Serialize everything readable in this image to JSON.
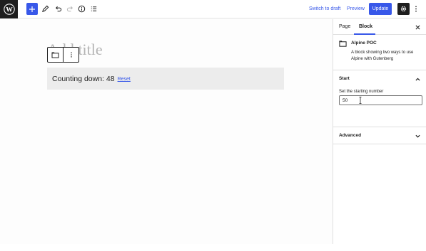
{
  "topbar": {
    "switch_to_draft_label": "Switch to draft",
    "preview_label": "Preview",
    "update_label": "Update"
  },
  "editor": {
    "title_placeholder": "Add title",
    "countdown_text": "Counting down: 48",
    "reset_label": "Reset"
  },
  "sidebar": {
    "tabs": [
      {
        "label": "Page",
        "active": false
      },
      {
        "label": "Block",
        "active": true
      }
    ],
    "block_card": {
      "name": "Alpine POC",
      "description": "A block showing two ways to use Alpine with Gutenberg",
      "icon": "block-rectangle-icon"
    },
    "panels": {
      "start": {
        "title": "Start",
        "field_label": "Set the starting number",
        "field_value": "50",
        "expanded": true
      },
      "advanced": {
        "title": "Advanced",
        "expanded": false
      }
    }
  },
  "colors": {
    "accent": "#3858e9",
    "dark": "#1e1e1e",
    "block_bg": "#ececec",
    "title_placeholder": "#b5b5b5"
  }
}
